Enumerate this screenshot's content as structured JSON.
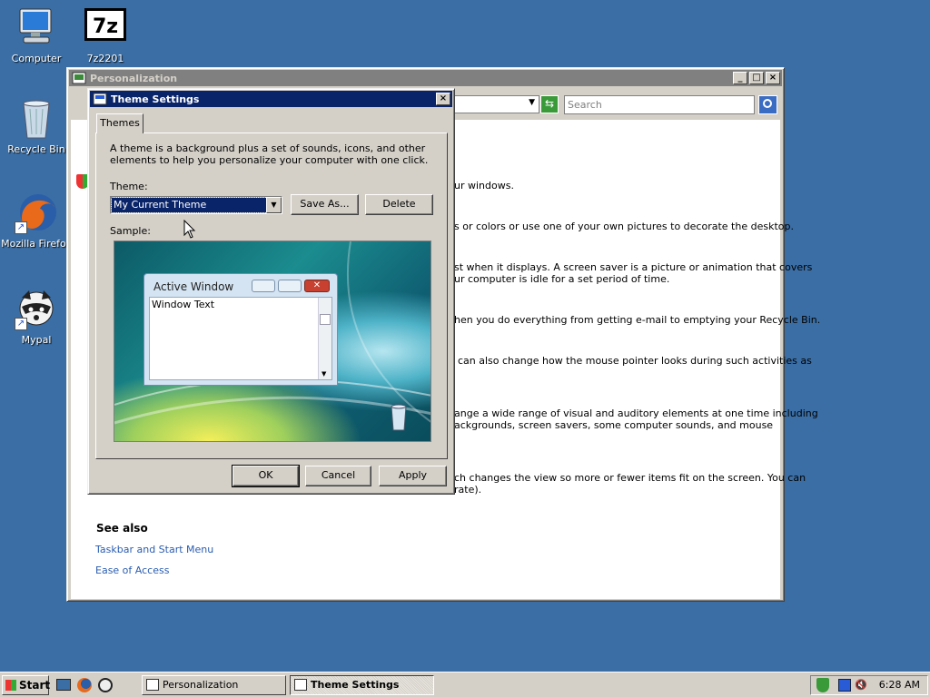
{
  "desktop": {
    "icons": [
      {
        "label": "Computer"
      },
      {
        "label": "7z2201"
      },
      {
        "label": "Recycle Bin"
      },
      {
        "label": "Mozilla Firefox"
      },
      {
        "label": "Mypal"
      }
    ]
  },
  "personalization": {
    "title": "Personalization",
    "search_placeholder": "Search",
    "fragments": [
      "ur windows.",
      "s or colors or use one of your own pictures to decorate the desktop.",
      "st when it displays. A screen saver is a picture or animation that covers",
      "ur computer is idle for a set period of time.",
      "hen you do everything from getting e-mail to emptying your Recycle Bin.",
      "can also change how the mouse pointer looks during such activities as",
      "ange a wide range of visual and auditory elements at one time including",
      "ackgrounds, screen savers, some computer sounds, and mouse",
      "ch changes the view so more or fewer items fit on the screen. You can",
      "rate)."
    ],
    "see_also_heading": "See also",
    "see_also_links": [
      "Taskbar and Start Menu",
      "Ease of Access"
    ]
  },
  "theme_settings": {
    "title": "Theme Settings",
    "tab_label": "Themes",
    "description_line1": "A theme is a background plus a set of sounds, icons, and other",
    "description_line2": "elements to help you personalize your computer with one click.",
    "theme_label": "Theme:",
    "theme_selected": "My Current Theme",
    "save_as_label": "Save As...",
    "delete_label": "Delete",
    "sample_label": "Sample:",
    "sample_window_title": "Active Window",
    "sample_window_text": "Window Text",
    "ok_label": "OK",
    "cancel_label": "Cancel",
    "apply_label": "Apply"
  },
  "taskbar": {
    "start_label": "Start",
    "tasks": [
      "Personalization",
      "Theme Settings"
    ],
    "clock": "6:28 AM"
  },
  "colors": {
    "desktop": "#3a6ea5",
    "active_title": "#0a246a",
    "inactive_title": "#808080",
    "link": "#2a5db0",
    "selection": "#0a246a"
  }
}
